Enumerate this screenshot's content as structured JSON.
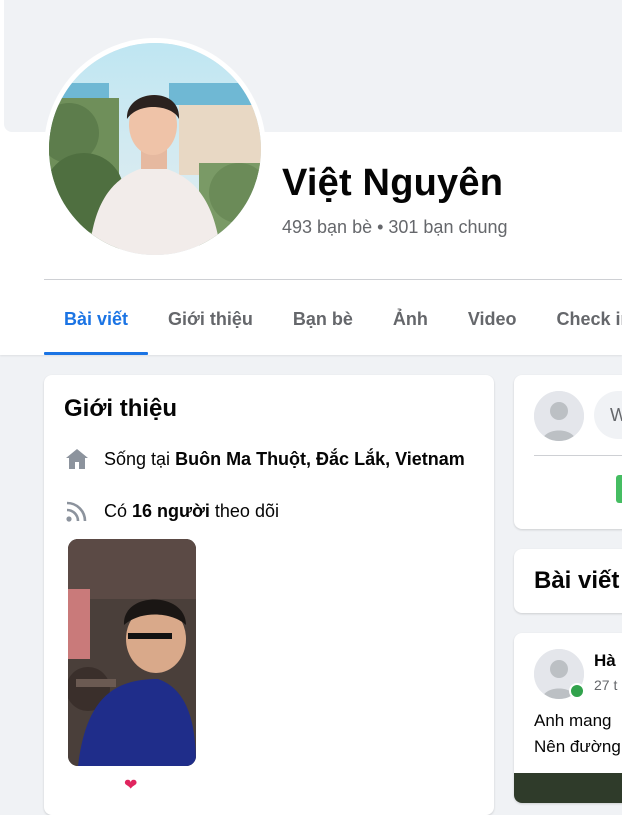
{
  "profile": {
    "name": "Việt Nguyên",
    "friends_summary": "493 bạn bè • 301 bạn chung"
  },
  "tabs": [
    {
      "label": "Bài viết",
      "active": true
    },
    {
      "label": "Giới thiệu",
      "active": false
    },
    {
      "label": "Bạn bè",
      "active": false
    },
    {
      "label": "Ảnh",
      "active": false
    },
    {
      "label": "Video",
      "active": false
    },
    {
      "label": "Check in",
      "active": false
    }
  ],
  "intro": {
    "title": "Giới thiệu",
    "lives_prefix": "Sống tại",
    "lives_place": "Buôn Ma Thuột, Đắc Lắk, Vietnam",
    "followers_prefix": "Có",
    "followers_count": "16 người",
    "followers_suffix": "theo dõi",
    "heart": "❤"
  },
  "composer": {
    "placeholder": "W"
  },
  "posts_section": {
    "title": "Bài viết"
  },
  "post": {
    "author": "Hà",
    "time": "27 t",
    "line1": "Anh mang",
    "line2": "Nên đường"
  },
  "colors": {
    "accent": "#1b74e4",
    "online": "#31a24c",
    "secondary_text": "#65676b"
  },
  "icons": {
    "home": "home-icon",
    "feed": "rss-icon"
  }
}
